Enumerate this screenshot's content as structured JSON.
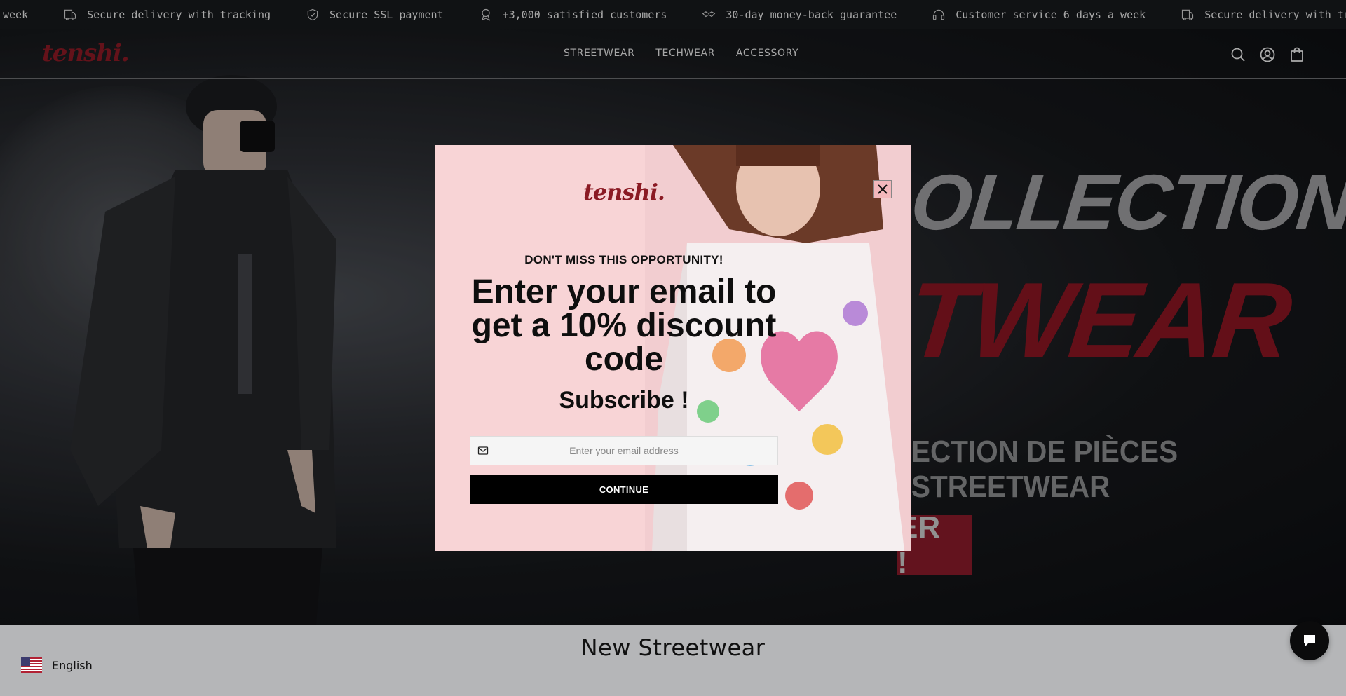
{
  "announcement": {
    "items": [
      {
        "text": "week",
        "icon": ""
      },
      {
        "text": "Secure delivery with tracking",
        "icon": "truck-icon"
      },
      {
        "text": "Secure SSL payment",
        "icon": "shield-icon"
      },
      {
        "text": "+3,000 satisfied customers",
        "icon": "award-icon"
      },
      {
        "text": "30-day money-back guarantee",
        "icon": "handshake-icon"
      },
      {
        "text": "Customer service 6 days a week",
        "icon": "headset-icon"
      },
      {
        "text": "Secure delivery with tracking",
        "icon": "truck-icon"
      }
    ]
  },
  "header": {
    "logo": "tenshi.",
    "nav": [
      "STREETWEAR",
      "TECHWEAR",
      "ACCESSORY"
    ]
  },
  "hero": {
    "title_line1": "OLLECTION",
    "title_line2": "TWEAR",
    "subtitle": "ECTION DE PIÈCES STREETWEAR",
    "cta": "ER !"
  },
  "modal": {
    "logo": "tenshi.",
    "kicker": "DON'T MISS THIS OPPORTUNITY!",
    "headline": "Enter your email to get a 10% discount code",
    "subscribe": "Subscribe !",
    "email_placeholder": "Enter your email address",
    "continue_label": "CONTINUE"
  },
  "bottom": {
    "section_title": "New Streetwear",
    "language": "English"
  },
  "colors": {
    "brand_red": "#8b1a24",
    "modal_bg": "#f8d4d6",
    "header_bg": "#17191d"
  }
}
